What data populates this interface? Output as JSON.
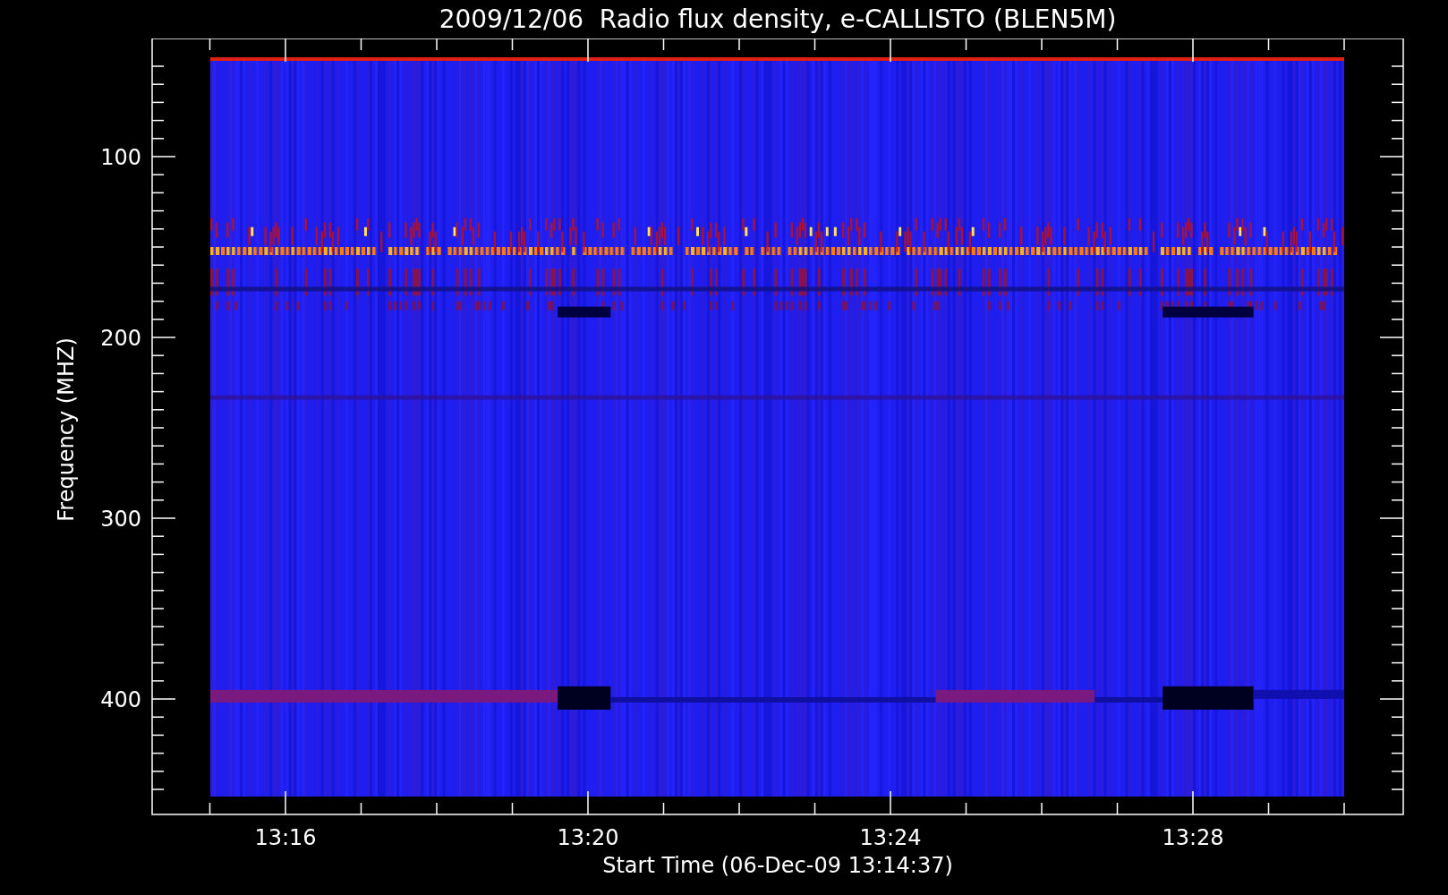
{
  "title": "2009/12/06  Radio flux density, e-CALLISTO (BLEN5M)",
  "y_axis": {
    "label": "Frequency (MHZ)",
    "ticks": [
      "100",
      "200",
      "300",
      "400"
    ]
  },
  "x_axis": {
    "label": "Start Time (06-Dec-09 13:14:37)",
    "ticks": [
      "13:16",
      "13:20",
      "13:24",
      "13:28"
    ]
  }
}
